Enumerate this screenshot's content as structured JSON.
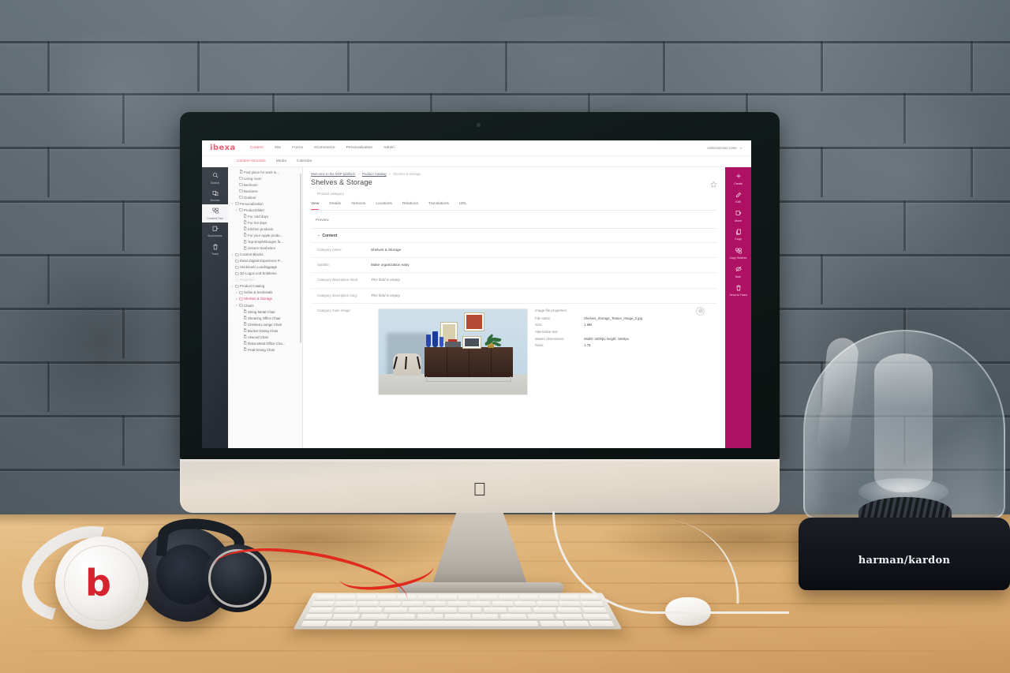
{
  "scene": {
    "device": "imac",
    "brand_logo": "",
    "speaker_label": "harman/kardon",
    "headphone_mark": "b"
  },
  "app": {
    "logo_text": "ibexa",
    "main_nav": [
      {
        "label": "Content",
        "active": true
      },
      {
        "label": "Site",
        "active": false
      },
      {
        "label": "Forms",
        "active": false
      },
      {
        "label": "eCommerce",
        "active": false
      },
      {
        "label": "Personalization",
        "active": false
      },
      {
        "label": "Admin",
        "active": false
      }
    ],
    "sub_nav": [
      {
        "label": "Content structure",
        "active": true
      },
      {
        "label": "Media",
        "active": false
      },
      {
        "label": "Calendar",
        "active": false
      }
    ],
    "user": {
      "name": "Administrator User",
      "chevron": "▾"
    },
    "rail": [
      {
        "label": "Search",
        "icon": "search-icon",
        "active": false
      },
      {
        "label": "Browse",
        "icon": "browse-icon",
        "active": false
      },
      {
        "label": "Content Tree",
        "icon": "content-tree-icon",
        "active": true
      },
      {
        "label": "Bookmarks",
        "icon": "bookmarks-icon",
        "active": false
      },
      {
        "label": "Trash",
        "icon": "trash-icon",
        "active": false
      }
    ],
    "tree": [
      {
        "label": "Find place for work in...",
        "depth": 2,
        "type": "file",
        "state": "partial"
      },
      {
        "label": "Living room",
        "depth": 2,
        "type": "folder"
      },
      {
        "label": "Bedroom",
        "depth": 2,
        "type": "folder"
      },
      {
        "label": "Business",
        "depth": 2,
        "type": "folder"
      },
      {
        "label": "Outdoor",
        "depth": 2,
        "type": "folder"
      },
      {
        "label": "Personalization",
        "depth": 1,
        "type": "folder",
        "expandable": true
      },
      {
        "label": "ProductSlider",
        "depth": 2,
        "type": "folder",
        "expandable": true
      },
      {
        "label": "For cold days",
        "depth": 3,
        "type": "file"
      },
      {
        "label": "For hot days",
        "depth": 3,
        "type": "file"
      },
      {
        "label": "Kitchen products",
        "depth": 3,
        "type": "file"
      },
      {
        "label": "For your Apple produ...",
        "depth": 3,
        "type": "file"
      },
      {
        "label": "Top-Empfehlungen fü...",
        "depth": 3,
        "type": "file"
      },
      {
        "label": "Unsere Neuheiten",
        "depth": 3,
        "type": "file"
      },
      {
        "label": "Content-Blocks",
        "depth": 1,
        "type": "folder",
        "expandable": true
      },
      {
        "label": "Ibexa Digital Experience P...",
        "depth": 1,
        "type": "folder"
      },
      {
        "label": "Hückmann Landingpage",
        "depth": 1,
        "type": "folder"
      },
      {
        "label": "3D-Logos und Embleme",
        "depth": 1,
        "type": "folder"
      },
      {
        "label": "Ratgeber",
        "depth": 1,
        "type": "folder",
        "dim": true
      },
      {
        "label": "Product Catalog",
        "depth": 1,
        "type": "folder",
        "expandable": true
      },
      {
        "label": "Sofas & Sectionals",
        "depth": 2,
        "type": "folder",
        "expandable": true
      },
      {
        "label": "Shelves & Storage",
        "depth": 2,
        "type": "folder",
        "expandable": true,
        "selected": true
      },
      {
        "label": "Chairs",
        "depth": 2,
        "type": "folder",
        "expandable": true
      },
      {
        "label": "String Metal Chair",
        "depth": 3,
        "type": "file"
      },
      {
        "label": "Shearing Office Chair",
        "depth": 3,
        "type": "file"
      },
      {
        "label": "Chelsea Lounge Chair",
        "depth": 3,
        "type": "file"
      },
      {
        "label": "Bucket Dining Chair",
        "depth": 3,
        "type": "file"
      },
      {
        "label": "Atwood Chair",
        "depth": 3,
        "type": "file"
      },
      {
        "label": "Roka Metal Office Cha...",
        "depth": 3,
        "type": "file"
      },
      {
        "label": "Pratt Dining Chair",
        "depth": 3,
        "type": "file"
      }
    ],
    "breadcrumb": {
      "items": [
        "Welcome to the DXP platform",
        "Product Catalog",
        "Shelves & Storage"
      ],
      "separator": "»"
    },
    "page": {
      "title": "Shelves & Storage",
      "subtitle": "Product category",
      "bookmark_icon": "star-icon"
    },
    "tabs": [
      {
        "label": "View",
        "active": true
      },
      {
        "label": "Details",
        "active": false
      },
      {
        "label": "Versions",
        "active": false
      },
      {
        "label": "Locations",
        "active": false
      },
      {
        "label": "Relations",
        "active": false
      },
      {
        "label": "Translations",
        "active": false
      },
      {
        "label": "URL",
        "active": false
      }
    ],
    "preview_label": "Preview",
    "content_section": {
      "title": "Content",
      "caret": "⌃",
      "fields": [
        {
          "label": "Category name:",
          "value": "Shelves & Storage",
          "empty": false
        },
        {
          "label": "Subtitle:",
          "value": "Make organization easy",
          "empty": false
        },
        {
          "label": "Category description short:",
          "value": "This field is empty",
          "empty": true
        },
        {
          "label": "Category description long:",
          "value": "This field is empty",
          "empty": true
        }
      ],
      "image_field": {
        "label": "Category main image:",
        "properties_title": "Image file properties:",
        "rows": [
          {
            "key": "File name:",
            "value": "Shelves_Storage_Teaser_Image_2.jpg"
          },
          {
            "key": "Size:",
            "value": "1 MB"
          },
          {
            "key": "Alternative text:",
            "value": ""
          },
          {
            "key": "Master dimensions:",
            "value": "Width: 3200px height: 1800px"
          },
          {
            "key": "Ratio:",
            "value": "1.78"
          }
        ],
        "action_icon": "image-variations-icon"
      }
    },
    "actions": [
      {
        "label": "Create",
        "icon": "plus-icon"
      },
      {
        "label": "Edit",
        "icon": "pencil-icon"
      },
      {
        "label": "Move",
        "icon": "move-icon"
      },
      {
        "label": "Copy",
        "icon": "copy-icon"
      },
      {
        "label": "Copy Subtree",
        "icon": "copy-subtree-icon"
      },
      {
        "label": "Hide",
        "icon": "hide-icon"
      },
      {
        "label": "Send to Trash",
        "icon": "send-to-trash-icon"
      }
    ],
    "colors": {
      "brand": "#e8455f",
      "action_bar": "#ae1164",
      "rail": "#1d222b",
      "selected_tree": "#d6336c"
    }
  }
}
